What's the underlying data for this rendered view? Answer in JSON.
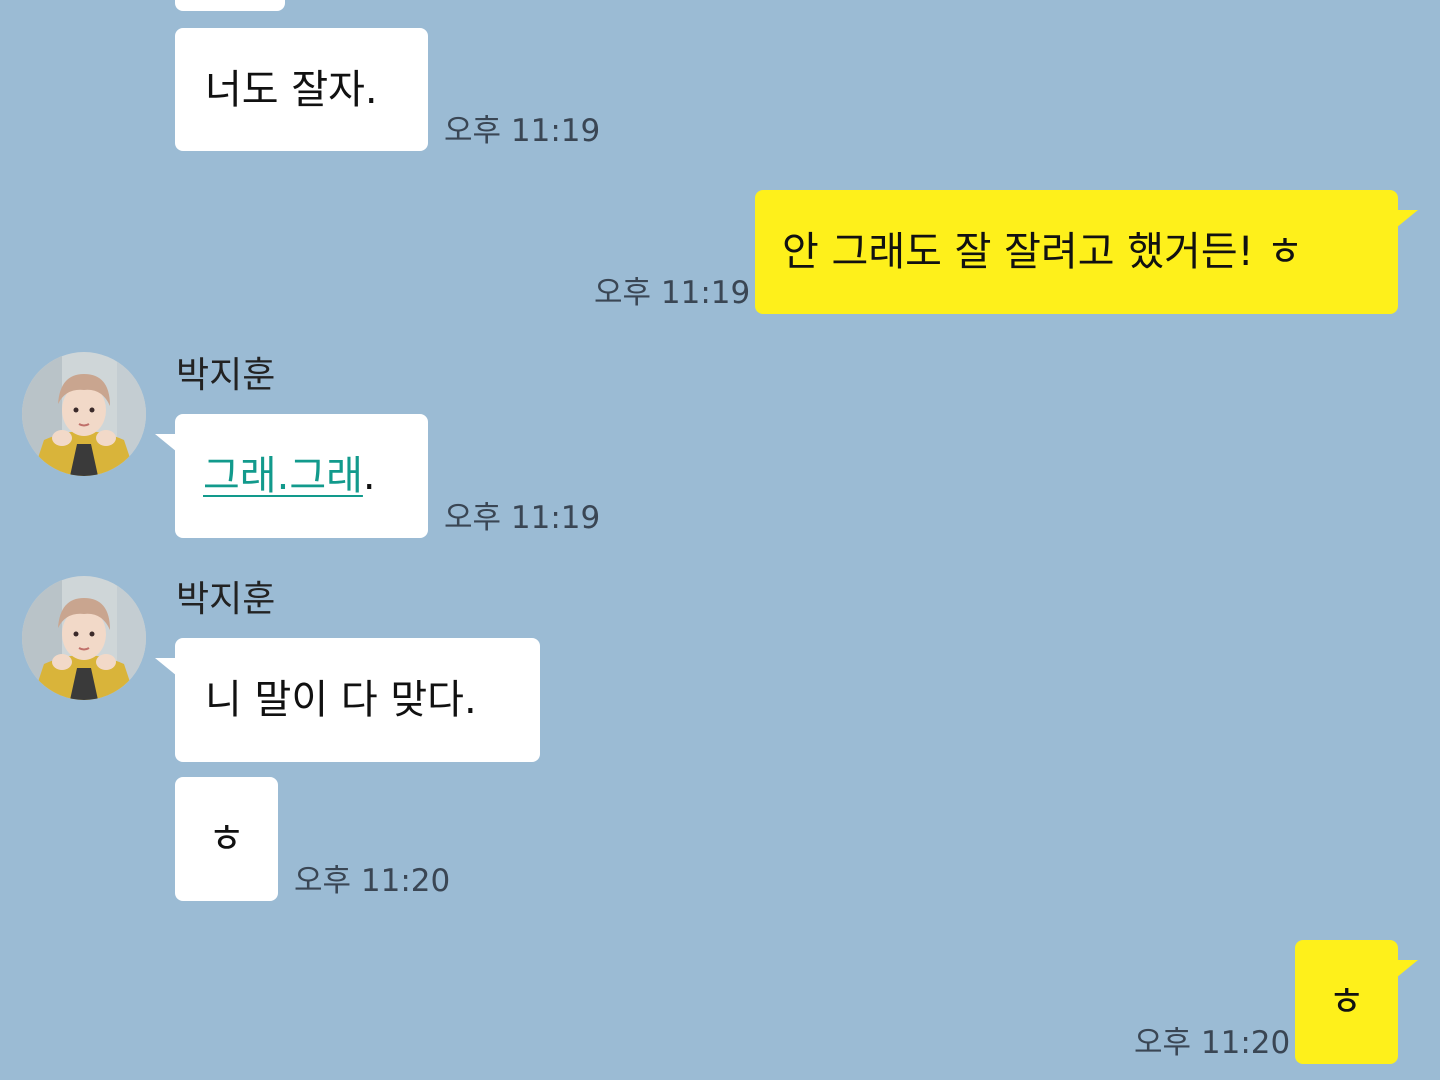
{
  "messages": [
    {
      "sender": "",
      "text": "너도 잘자.",
      "time": "오후 11:19"
    },
    {
      "sender": "me",
      "text": "안 그래도 잘 잘려고 했거든! ㅎ",
      "time": "오후 11:19"
    },
    {
      "sender": "박지훈",
      "text_link": "그래.그래",
      "text_tail": ".",
      "time": "오후 11:19"
    },
    {
      "sender": "박지훈",
      "text": "니 말이 다 맞다.",
      "time": ""
    },
    {
      "sender": "박지훈",
      "text": "ㅎ",
      "time": "오후 11:20"
    },
    {
      "sender": "me",
      "text": "ㅎ",
      "time": "오후 11:20"
    }
  ],
  "colors": {
    "background": "#9bbbd4",
    "incoming_bubble": "#ffffff",
    "outgoing_bubble": "#fef01b",
    "link": "#129a8c"
  },
  "icons": {
    "avatar": "profile-photo-avatar"
  }
}
